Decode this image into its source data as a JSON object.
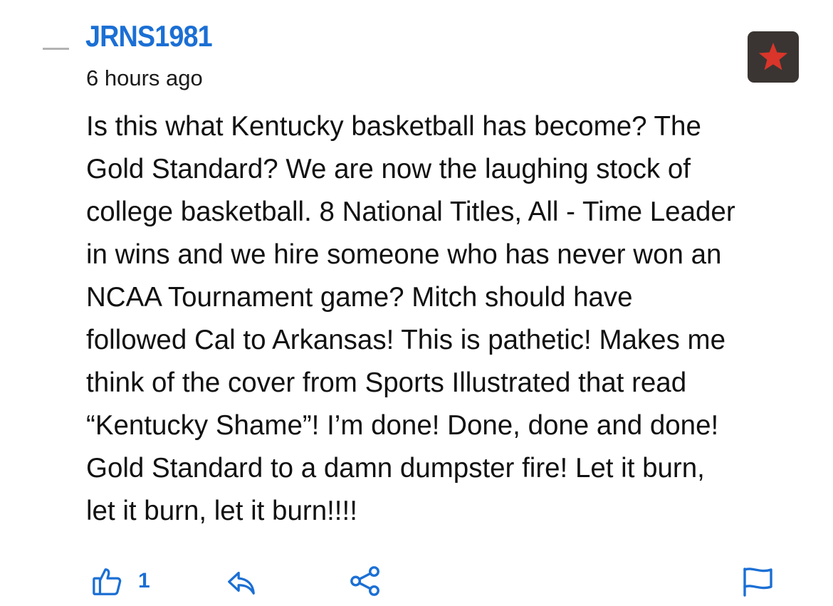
{
  "comment": {
    "username": "JRNS1981",
    "timestamp": "6 hours ago",
    "body_lines": [
      "Is this what Kentucky basketball has become? The",
      "Gold Standard? We are now the laughing stock of",
      "college basketball. 8 National Titles, All - Time Leader",
      "in wins and we hire someone who has never won an",
      "NCAA Tournament game? Mitch should have",
      "followed Cal to Arkansas! This is pathetic! Makes me",
      "think of the cover from Sports Illustrated that read",
      "“Kentucky Shame”! I’m done! Done, done and done!",
      "Gold Standard to a damn dumpster fire! Let it burn,",
      "let it burn, let it burn!!!!"
    ]
  },
  "actions": {
    "like_count": "1"
  },
  "icons": {
    "collapse": "collapse-dash-icon",
    "badge": "star-icon",
    "like": "thumbs-up-icon",
    "reply": "reply-arrow-icon",
    "share": "share-icon",
    "report": "flag-icon"
  },
  "colors": {
    "username": "#1b6fd4",
    "icon_blue": "#1b6fd4",
    "badge_bg": "#3a3532",
    "star": "#d9352a",
    "text": "#111111"
  }
}
